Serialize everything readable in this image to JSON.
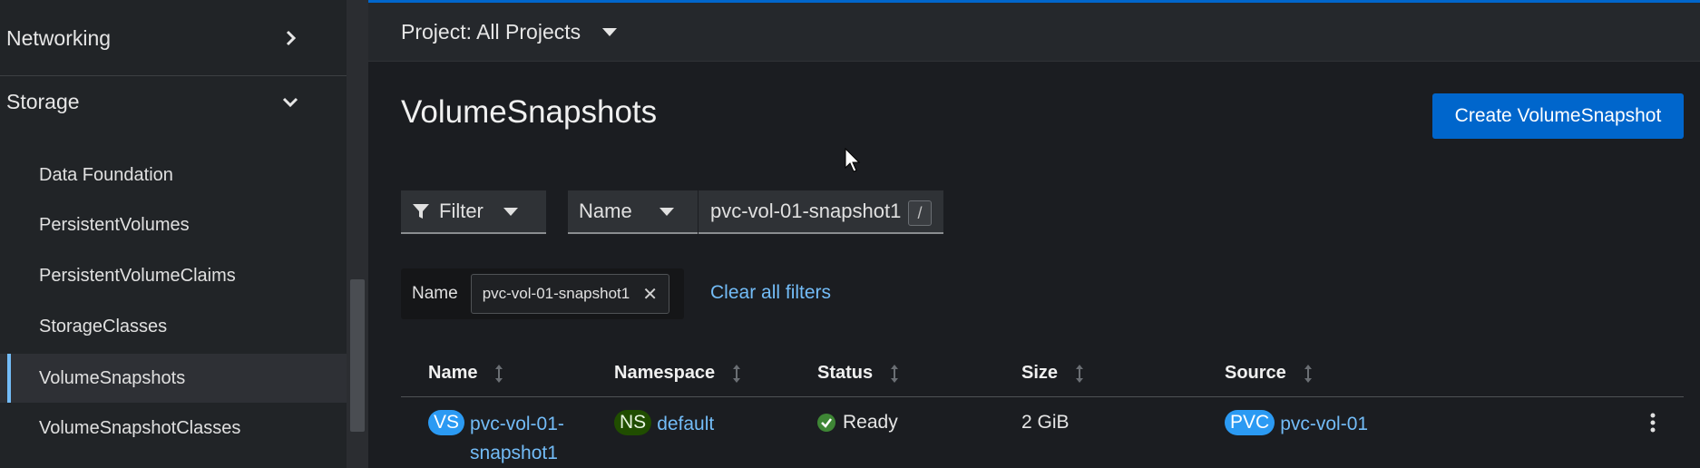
{
  "sidebar": {
    "sections": [
      {
        "label": "Networking",
        "state": "collapsed"
      },
      {
        "label": "Storage",
        "state": "expanded"
      }
    ],
    "items": [
      {
        "label": "Data Foundation"
      },
      {
        "label": "PersistentVolumes"
      },
      {
        "label": "PersistentVolumeClaims"
      },
      {
        "label": "StorageClasses"
      },
      {
        "label": "VolumeSnapshots",
        "active": true
      },
      {
        "label": "VolumeSnapshotClasses"
      }
    ]
  },
  "topbar": {
    "project_label": "Project: All Projects"
  },
  "page": {
    "title": "VolumeSnapshots",
    "create_button": "Create VolumeSnapshot"
  },
  "toolbar": {
    "filter_label": "Filter",
    "attribute_select": "Name",
    "search_value": "pvc-vol-01-snapshot1",
    "shortcut_hint": "/"
  },
  "chips": {
    "group_label": "Name",
    "chip_value": "pvc-vol-01-snapshot1",
    "clear_all": "Clear all filters"
  },
  "table": {
    "columns": [
      "Name",
      "Namespace",
      "Status",
      "Size",
      "Source"
    ],
    "rows": [
      {
        "name_badge": "VS",
        "name_line1": "pvc-vol-01-",
        "name_line2": "snapshot1",
        "namespace_badge": "NS",
        "namespace": "default",
        "status": "Ready",
        "size": "2 GiB",
        "source_badge": "PVC",
        "source": "pvc-vol-01"
      }
    ]
  },
  "colors": {
    "accent": "#0066cc",
    "link": "#73bcf7",
    "status_ok": "#3e8635"
  }
}
